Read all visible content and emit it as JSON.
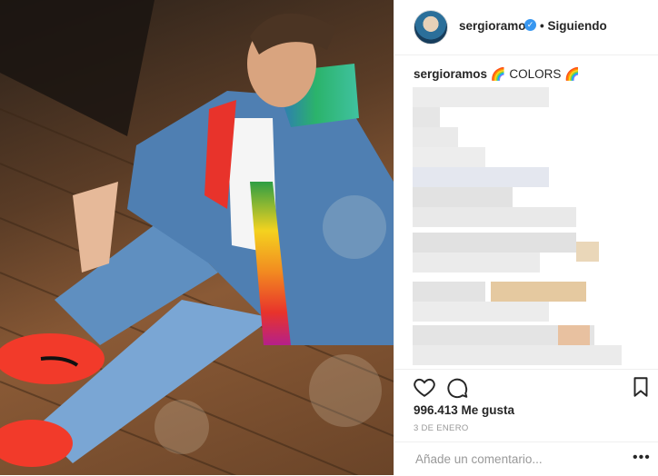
{
  "post": {
    "image_alt": "Man in denim jacket and rainbow hoodie sitting on a wooden deck wearing red sneakers"
  },
  "header": {
    "username": "sergioramos",
    "verified_icon": "verified-badge-icon",
    "follow_state": "• Siguiendo"
  },
  "caption": {
    "username": "sergioramos",
    "text": "🌈 COLORS 🌈"
  },
  "actions": {
    "like_icon": "heart-icon",
    "comment_icon": "comment-icon",
    "save_icon": "bookmark-icon"
  },
  "stats": {
    "likes": "996.413 Me gusta",
    "date": "3 DE ENERO"
  },
  "comment_box": {
    "placeholder": "Añade un comentario...",
    "more_label": "•••"
  },
  "colors": {
    "accent": "#3897f0",
    "text": "#262626",
    "muted": "#999999"
  }
}
